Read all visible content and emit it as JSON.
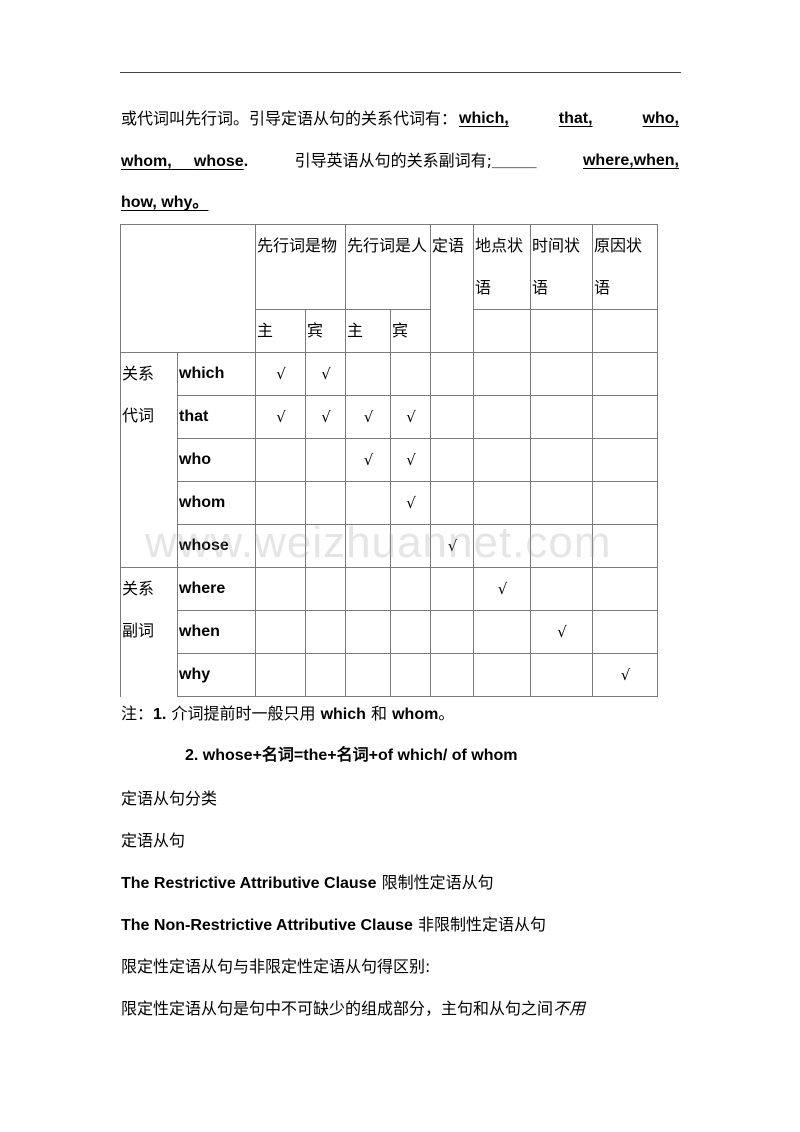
{
  "intro": {
    "line1_text": "或代词叫先行词。引导定语从句的关系代词有：",
    "line1_pronouns": [
      "which,",
      "that,",
      "who,"
    ],
    "line2_pronouns": [
      "whom,",
      "whose"
    ],
    "line2_period": ".",
    "line2_text": "引导英语从句的关系副词有;",
    "line2_blank": "_____",
    "line2_adverbs": "where,when,",
    "line3_adverbs": "how, why。"
  },
  "table": {
    "header": {
      "thing": "先行词是物",
      "person": "先行词是人",
      "attributive": "定语",
      "place": "地点状语",
      "time": "时间状语",
      "reason": "原因状语",
      "subject": "主",
      "object": "宾"
    },
    "groups": [
      {
        "label": "关系代词"
      },
      {
        "label": "关系副词"
      }
    ],
    "check_mark": "√",
    "rows": [
      {
        "word": "which",
        "checks": [
          true,
          true,
          false,
          false,
          false,
          false,
          false,
          false
        ]
      },
      {
        "word": "that",
        "checks": [
          true,
          true,
          true,
          true,
          false,
          false,
          false,
          false
        ]
      },
      {
        "word": "who",
        "checks": [
          false,
          false,
          true,
          true,
          false,
          false,
          false,
          false
        ]
      },
      {
        "word": "whom",
        "checks": [
          false,
          false,
          false,
          true,
          false,
          false,
          false,
          false
        ]
      },
      {
        "word": "whose",
        "checks": [
          false,
          false,
          false,
          false,
          true,
          false,
          false,
          false
        ]
      },
      {
        "word": "where",
        "checks": [
          false,
          false,
          false,
          false,
          false,
          true,
          false,
          false
        ]
      },
      {
        "word": "when",
        "checks": [
          false,
          false,
          false,
          false,
          false,
          false,
          true,
          false
        ]
      },
      {
        "word": "why",
        "checks": [
          false,
          false,
          false,
          false,
          false,
          false,
          false,
          true
        ]
      }
    ]
  },
  "notes": {
    "note1_prefix": "注：",
    "note1_num": "1.",
    "note1_text": "介词提前时一般只用",
    "note1_which": "which",
    "note1_and": "和",
    "note1_whom": "whom",
    "note1_end": "。",
    "note2": "2. whose+名词=the+名词+of which/ of whom"
  },
  "body": {
    "classification": "定语从句分类",
    "clause": "定语从句",
    "restrictive_en": "The Restrictive Attributive Clause",
    "restrictive_zh": "限制性定语从句",
    "nonrestrictive_en": "The Non-Restrictive Attributive Clause",
    "nonrestrictive_zh": "非限制性定语从句",
    "difference": "限定性定语从句与非限定性定语从句得区别:",
    "last_line": "限定性定语从句是句中不可缺少的组成部分，主句和从句之间",
    "last_italic": "不用"
  },
  "watermark": "www.weizhuannet.com"
}
